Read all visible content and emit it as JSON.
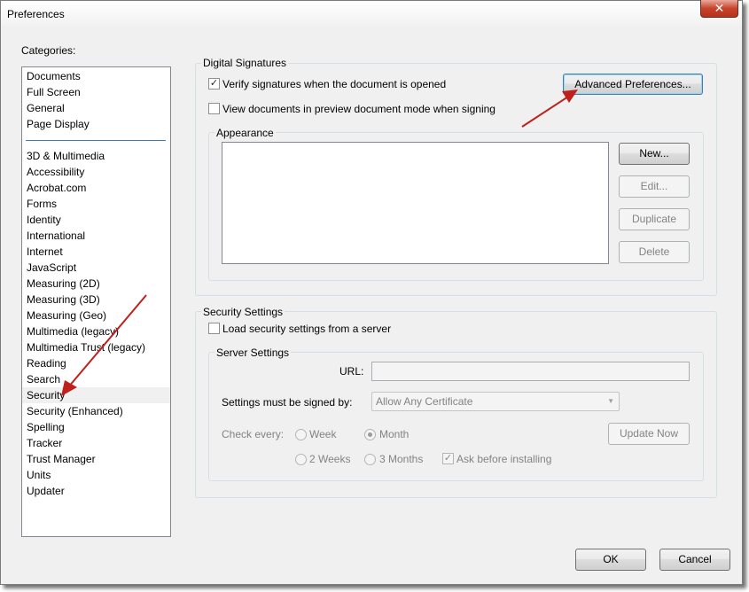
{
  "window": {
    "title": "Preferences",
    "close_glyph": "✕"
  },
  "categories": {
    "label": "Categories:",
    "group1": [
      "Documents",
      "Full Screen",
      "General",
      "Page Display"
    ],
    "group2": [
      "3D & Multimedia",
      "Accessibility",
      "Acrobat.com",
      "Forms",
      "Identity",
      "International",
      "Internet",
      "JavaScript",
      "Measuring (2D)",
      "Measuring (3D)",
      "Measuring (Geo)",
      "Multimedia (legacy)",
      "Multimedia Trust (legacy)",
      "Reading",
      "Search",
      "Security",
      "Security (Enhanced)",
      "Spelling",
      "Tracker",
      "Trust Manager",
      "Units",
      "Updater"
    ],
    "selected": "Security"
  },
  "digital_signatures": {
    "title": "Digital Signatures",
    "verify_label": "Verify signatures when the document is opened",
    "verify_checked": true,
    "preview_label": "View documents in preview document mode when signing",
    "preview_checked": false,
    "advanced_button": "Advanced Preferences...",
    "appearance": {
      "title": "Appearance",
      "new_button": "New...",
      "edit_button": "Edit...",
      "duplicate_button": "Duplicate",
      "delete_button": "Delete"
    }
  },
  "security_settings": {
    "title": "Security Settings",
    "load_label": "Load security settings from a server",
    "load_checked": false,
    "server": {
      "title": "Server Settings",
      "url_label": "URL:",
      "url_value": "",
      "signed_by_label": "Settings must be signed by:",
      "signed_by_value": "Allow Any Certificate",
      "check_every_label": "Check every:",
      "options": [
        "Week",
        "Month",
        "2 Weeks",
        "3 Months"
      ],
      "selected_option": "Month",
      "ask_label": "Ask before installing",
      "ask_checked": true,
      "update_button": "Update Now"
    }
  },
  "footer": {
    "ok_button": "OK",
    "cancel_button": "Cancel"
  },
  "colors": {
    "annotation_arrow": "#c0201c",
    "focus_border": "#3c7fb1"
  },
  "icons": {
    "check_mark": "✓",
    "dropdown_arrow": "▼"
  }
}
